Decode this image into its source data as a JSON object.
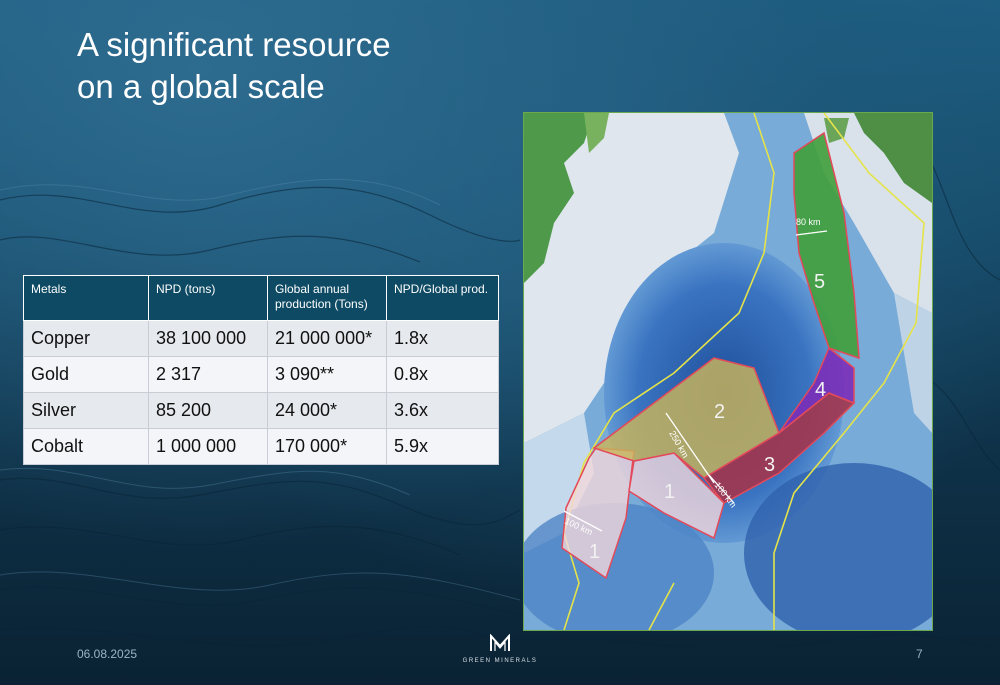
{
  "slide": {
    "title_line1": "A significant resource",
    "title_line2": "on a global scale",
    "date": "06.08.2025",
    "page_number": "7"
  },
  "brand": {
    "logo_text": "GREEN MINERALS"
  },
  "table": {
    "headers": [
      "Metals",
      "NPD (tons)",
      "Global annual production (Tons)",
      "NPD/Global prod."
    ],
    "rows": [
      [
        "Copper",
        "38 100 000",
        "21 000 000*",
        "1.8x"
      ],
      [
        "Gold",
        "2 317",
        "3 090**",
        "0.8x"
      ],
      [
        "Silver",
        "85 200",
        "24 000*",
        "3.6x"
      ],
      [
        "Cobalt",
        "1 000 000",
        "170 000*",
        "5.9x"
      ]
    ]
  },
  "map": {
    "area_labels": [
      "1",
      "1",
      "2",
      "3",
      "4",
      "5"
    ],
    "distance_labels": [
      "80 km",
      "250 km",
      "100 km",
      "100 km"
    ],
    "colors": {
      "area_1": "#f2d7dc",
      "area_2": "#c9b55a",
      "area_3": "#a2354e",
      "area_4": "#7a2db8",
      "area_5": "#3f9e3a",
      "boundary": "#e24a5a",
      "yellow_line": "#e4e34a"
    }
  }
}
